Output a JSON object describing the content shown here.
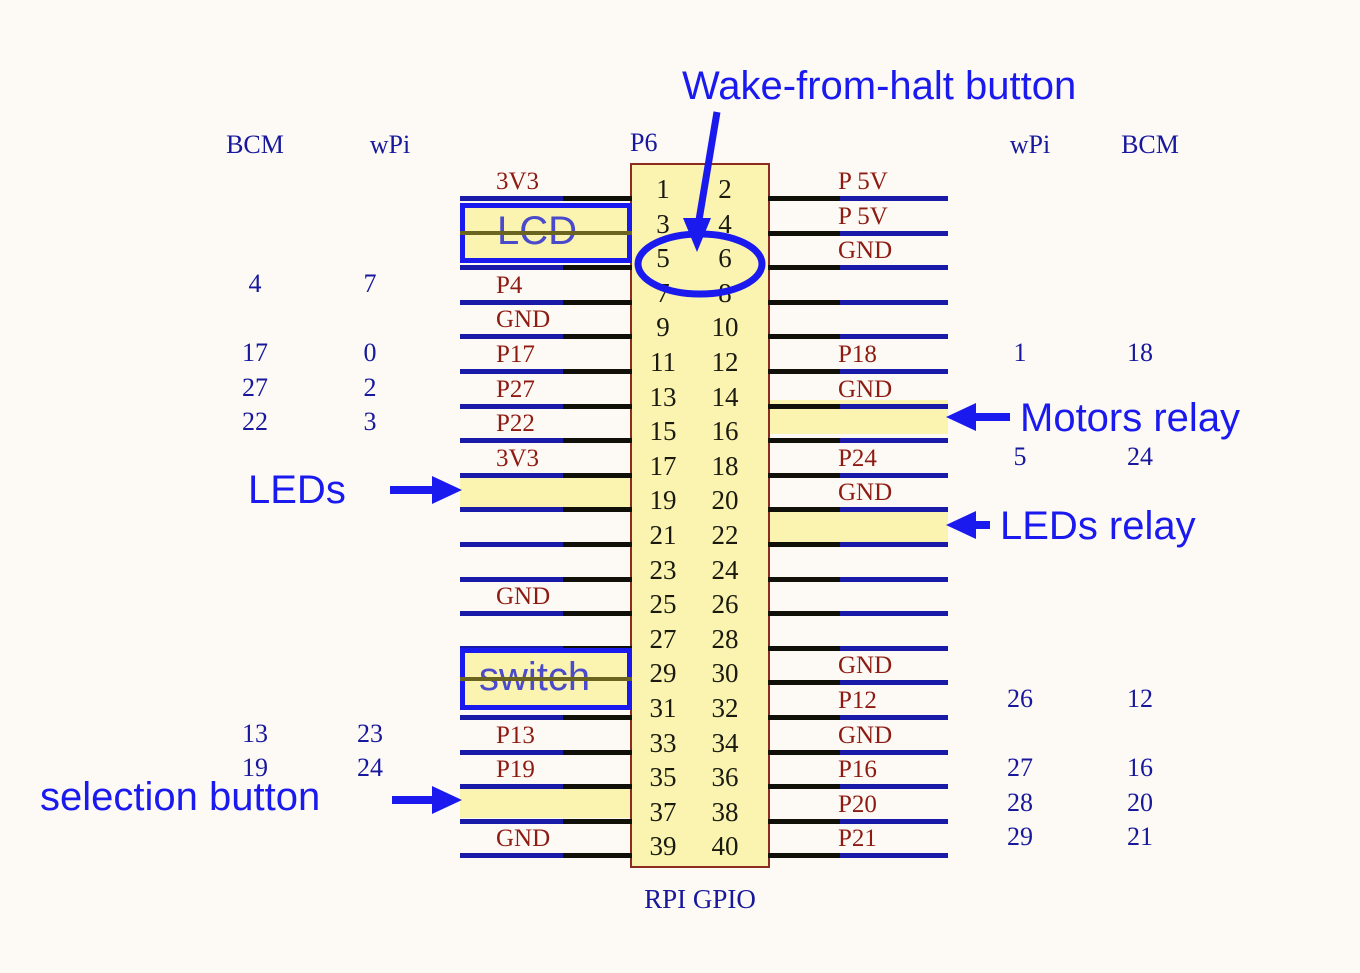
{
  "figure": {
    "caption": "RPI GPIO",
    "header_left_bcm": "BCM",
    "header_left_wpi": "wPi",
    "header_right_wpi": "wPi",
    "header_right_bcm": "BCM",
    "connector_label": "P6",
    "colors": {
      "background": "#fdfaf6",
      "annotation_blue": "#1a1aee",
      "signal_red": "#8d1b12",
      "number_navy": "#17189c",
      "pin_block_yellow": "#faf4b0",
      "pin_block_border": "#8d2d20",
      "wire_black": "#100f08",
      "wire_blue": "#1a1aa8"
    }
  },
  "pins": {
    "odd": [
      "1",
      "3",
      "5",
      "7",
      "9",
      "11",
      "13",
      "15",
      "17",
      "19",
      "21",
      "23",
      "25",
      "27",
      "29",
      "31",
      "33",
      "35",
      "37",
      "39"
    ],
    "even": [
      "2",
      "4",
      "6",
      "8",
      "10",
      "12",
      "14",
      "16",
      "18",
      "20",
      "22",
      "24",
      "26",
      "28",
      "30",
      "32",
      "34",
      "36",
      "38",
      "40"
    ]
  },
  "left_rows": [
    {
      "pin": "1",
      "signal": "3V3",
      "bcm": "",
      "wpi": "",
      "highlight": false
    },
    {
      "pin": "3",
      "signal": "",
      "bcm": "",
      "wpi": "",
      "highlight": true
    },
    {
      "pin": "5",
      "signal": "",
      "bcm": "",
      "wpi": "",
      "highlight": true
    },
    {
      "pin": "7",
      "signal": "P4",
      "bcm": "4",
      "wpi": "7",
      "highlight": false
    },
    {
      "pin": "9",
      "signal": "GND",
      "bcm": "",
      "wpi": "",
      "highlight": false
    },
    {
      "pin": "11",
      "signal": "P17",
      "bcm": "17",
      "wpi": "0",
      "highlight": false
    },
    {
      "pin": "13",
      "signal": "P27",
      "bcm": "27",
      "wpi": "2",
      "highlight": false
    },
    {
      "pin": "15",
      "signal": "P22",
      "bcm": "22",
      "wpi": "3",
      "highlight": false
    },
    {
      "pin": "17",
      "signal": "3V3",
      "bcm": "",
      "wpi": "",
      "highlight": false
    },
    {
      "pin": "19",
      "signal": "",
      "bcm": "",
      "wpi": "",
      "highlight": true
    },
    {
      "pin": "21",
      "signal": "",
      "bcm": "",
      "wpi": "",
      "highlight": false
    },
    {
      "pin": "23",
      "signal": "",
      "bcm": "",
      "wpi": "",
      "highlight": false
    },
    {
      "pin": "25",
      "signal": "GND",
      "bcm": "",
      "wpi": "",
      "highlight": false
    },
    {
      "pin": "27",
      "signal": "",
      "bcm": "",
      "wpi": "",
      "highlight": false
    },
    {
      "pin": "29",
      "signal": "",
      "bcm": "",
      "wpi": "",
      "highlight": true
    },
    {
      "pin": "31",
      "signal": "",
      "bcm": "",
      "wpi": "",
      "highlight": true
    },
    {
      "pin": "33",
      "signal": "P13",
      "bcm": "13",
      "wpi": "23",
      "highlight": false
    },
    {
      "pin": "35",
      "signal": "P19",
      "bcm": "19",
      "wpi": "24",
      "highlight": false
    },
    {
      "pin": "37",
      "signal": "",
      "bcm": "",
      "wpi": "",
      "highlight": true
    },
    {
      "pin": "39",
      "signal": "GND",
      "bcm": "",
      "wpi": "",
      "highlight": false
    }
  ],
  "right_rows": [
    {
      "pin": "2",
      "signal": "P 5V",
      "wpi": "",
      "bcm": "",
      "highlight": false
    },
    {
      "pin": "4",
      "signal": "P 5V",
      "wpi": "",
      "bcm": "",
      "highlight": false
    },
    {
      "pin": "6",
      "signal": "GND",
      "wpi": "",
      "bcm": "",
      "highlight": false
    },
    {
      "pin": "8",
      "signal": "",
      "wpi": "",
      "bcm": "",
      "highlight": false
    },
    {
      "pin": "10",
      "signal": "",
      "wpi": "",
      "bcm": "",
      "highlight": false
    },
    {
      "pin": "12",
      "signal": "P18",
      "wpi": "1",
      "bcm": "18",
      "highlight": false
    },
    {
      "pin": "14",
      "signal": "GND",
      "wpi": "",
      "bcm": "",
      "highlight": false
    },
    {
      "pin": "16",
      "signal": "",
      "wpi": "",
      "bcm": "",
      "highlight": true
    },
    {
      "pin": "18",
      "signal": "P24",
      "wpi": "5",
      "bcm": "24",
      "highlight": false
    },
    {
      "pin": "20",
      "signal": "GND",
      "wpi": "",
      "bcm": "",
      "highlight": false
    },
    {
      "pin": "22",
      "signal": "",
      "wpi": "",
      "bcm": "",
      "highlight": true
    },
    {
      "pin": "24",
      "signal": "",
      "wpi": "",
      "bcm": "",
      "highlight": false
    },
    {
      "pin": "26",
      "signal": "",
      "wpi": "",
      "bcm": "",
      "highlight": false
    },
    {
      "pin": "28",
      "signal": "",
      "wpi": "",
      "bcm": "",
      "highlight": false
    },
    {
      "pin": "30",
      "signal": "GND",
      "wpi": "",
      "bcm": "",
      "highlight": false
    },
    {
      "pin": "32",
      "signal": "P12",
      "wpi": "26",
      "bcm": "12",
      "highlight": false
    },
    {
      "pin": "34",
      "signal": "GND",
      "wpi": "",
      "bcm": "",
      "highlight": false
    },
    {
      "pin": "36",
      "signal": "P16",
      "wpi": "27",
      "bcm": "16",
      "highlight": false
    },
    {
      "pin": "38",
      "signal": "P20",
      "wpi": "28",
      "bcm": "20",
      "highlight": false
    },
    {
      "pin": "40",
      "signal": "P21",
      "wpi": "29",
      "bcm": "21",
      "highlight": false
    }
  ],
  "annotations": {
    "wake_button": "Wake-from-halt button",
    "lcd_box": "LCD",
    "switch_box": "switch",
    "leds": "LEDs",
    "selection_button": "selection button",
    "motors_relay": "Motors relay",
    "leds_relay": "LEDs relay"
  }
}
